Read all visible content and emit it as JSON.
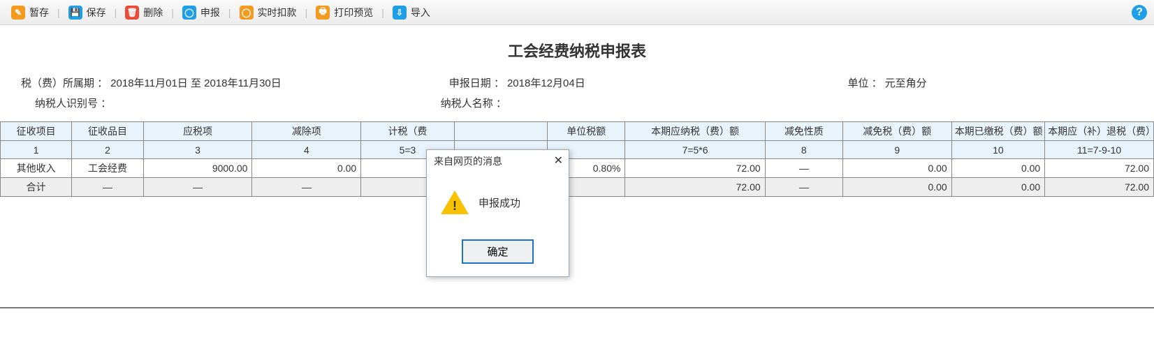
{
  "toolbar": {
    "save_draft": "暂存",
    "save": "保存",
    "delete": "删除",
    "declare": "申报",
    "deduct": "实时扣款",
    "print": "打印预览",
    "import": "导入"
  },
  "title": "工会经费纳税申报表",
  "info": {
    "period_label": "税（费）所属期 ：",
    "period_value": "2018年11月01日  至  2018年11月30日",
    "declare_date_label": "申报日期 ：",
    "declare_date_value": "2018年12月04日",
    "unit_label": "单位 ：",
    "unit_value": "元至角分",
    "taxpayer_id_label": "纳税人识别号 ：",
    "taxpayer_id_value": "",
    "taxpayer_name_label": "纳税人名称 ：",
    "taxpayer_name_value": ""
  },
  "headers": [
    "征收项目",
    "征收品目",
    "应税项",
    "减除项",
    "计税（费",
    "",
    "单位税额",
    "本期应纳税（费）额",
    "减免性质",
    "减免税（费）额",
    "本期已缴税（费）额",
    "本期应（补）退税（费）额"
  ],
  "index_row": [
    "1",
    "2",
    "3",
    "4",
    "5=3",
    "",
    "",
    "7=5*6",
    "8",
    "9",
    "10",
    "11=7-9-10"
  ],
  "rows": [
    {
      "c0": "其他收入",
      "c1": "工会经费",
      "c2": "9000.00",
      "c3": "0.00",
      "c4": "",
      "c5": "",
      "c6": "0.80%",
      "c7": "72.00",
      "c8": "—",
      "c9": "0.00",
      "c10": "0.00",
      "c11": "72.00"
    }
  ],
  "total_row": {
    "label": "合计",
    "c1": "—",
    "c2": "—",
    "c3": "—",
    "c4": "",
    "c5": "",
    "c6": "",
    "c7": "72.00",
    "c8": "—",
    "c9": "0.00",
    "c10": "0.00",
    "c11": "72.00"
  },
  "dialog": {
    "title": "来自网页的消息",
    "message": "申报成功",
    "ok": "确定"
  }
}
